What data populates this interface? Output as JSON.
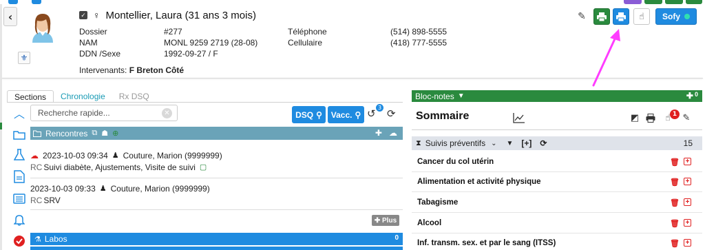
{
  "colors": {
    "accent_blue": "#1f8be0",
    "accent_green": "#2a8a3e",
    "teal_header": "#6aa3b8",
    "danger_red": "#e02020",
    "annotation_magenta": "#ff3cff"
  },
  "patient": {
    "name": "Montellier, Laura (31 ans 3 mois)",
    "fields_left": [
      {
        "label": "Dossier",
        "value": "#277"
      },
      {
        "label": "NAM",
        "value": "MONL 9259 2719 (28-08)"
      },
      {
        "label": "DDN /Sexe",
        "value": "1992-09-27 / F"
      }
    ],
    "fields_right": [
      {
        "label": "Téléphone",
        "value": "(514) 898-5555"
      },
      {
        "label": "Cellulaire",
        "value": "(418) 777-5555"
      }
    ],
    "intervenants_label": "Intervenants:",
    "intervenants_value": "F Breton Côté"
  },
  "header_actions": {
    "sofy_label": "Sofy"
  },
  "left_tabs": [
    {
      "label": "Sections",
      "state": "active"
    },
    {
      "label": "Chronologie",
      "state": "normal"
    },
    {
      "label": "Rx DSQ",
      "state": "disabled"
    }
  ],
  "search": {
    "placeholder": "Recherche rapide...",
    "dsq_label": "DSQ",
    "vacc_label": "Vacc.",
    "history_badge": "3"
  },
  "rencontres": {
    "title": "Rencontres",
    "items": [
      {
        "date": "2023-10-03 09:34",
        "person": "Couture, Marion (9999999)",
        "type": "RC",
        "detail": "Suivi diabète, Ajustements, Visite de suivi"
      },
      {
        "date": "2023-10-03 09:33",
        "person": "Couture, Marion (9999999)",
        "type": "RC",
        "detail": "SRV"
      }
    ],
    "more_label": "Plus"
  },
  "labos": {
    "title": "Labos",
    "count": "0"
  },
  "bloc_notes": {
    "title": "Bloc-notes",
    "count": "0"
  },
  "sommaire": {
    "title": "Sommaire",
    "badge": "1"
  },
  "suivis": {
    "title": "Suivis préventifs",
    "add_label": "[+]",
    "count": "15",
    "items": [
      "Cancer du col utérin",
      "Alimentation et activité physique",
      "Tabagisme",
      "Alcool",
      "Inf. transm. sex. et par le sang (ITSS)"
    ]
  }
}
